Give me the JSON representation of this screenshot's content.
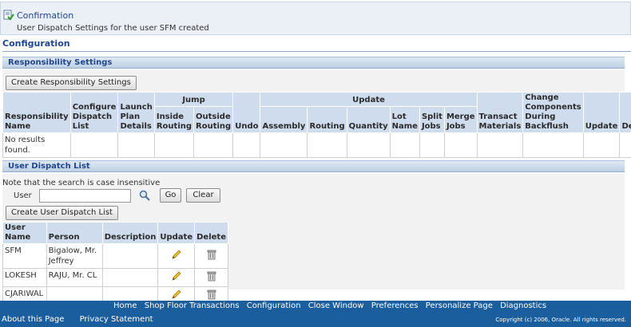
{
  "confirmation": {
    "title": "Confirmation",
    "message": "User Dispatch Settings for the user SFM created"
  },
  "page_title": "Configuration",
  "responsibility": {
    "header": "Responsibility Settings",
    "create_button": "Create Responsibility Settings",
    "group_jump": "Jump",
    "group_update": "Update",
    "columns": {
      "resp_name": "Responsibility Name",
      "configure": "Configure Dispatch List",
      "launch": "Launch Plan Details",
      "inside": "Inside Routing",
      "outside": "Outside Routing",
      "undo": "Undo",
      "assembly": "Assembly",
      "routing": "Routing",
      "quantity": "Quantity",
      "lot": "Lot Name",
      "split": "Split Jobs",
      "merge": "Merge Jobs",
      "transact": "Transact Materials",
      "change": "Change Components During Backflush",
      "update": "Update",
      "delete": "Delete"
    },
    "empty_text": "No results found."
  },
  "dispatch": {
    "header": "User Dispatch List",
    "note": "Note that the search is case insensitive",
    "user_label": "User",
    "user_value": "",
    "go_button": "Go",
    "clear_button": "Clear",
    "create_button": "Create User Dispatch List",
    "columns": {
      "user_name": "User Name",
      "person": "Person",
      "description": "Description",
      "update": "Update",
      "delete": "Delete"
    },
    "rows": [
      {
        "user_name": "SFM",
        "person": "Bigalow, Mr. Jeffrey",
        "description": ""
      },
      {
        "user_name": "LOKESH",
        "person": "RAJU, Mr. CL",
        "description": ""
      },
      {
        "user_name": "CJARIWAL",
        "person": "",
        "description": ""
      }
    ]
  },
  "footer": {
    "links": [
      "Home",
      "Shop Floor Transactions",
      "Configuration",
      "Close Window",
      "Preferences",
      "Personalize Page",
      "Diagnostics"
    ],
    "about": "About this Page",
    "privacy": "Privacy Statement",
    "copyright": "Copyright (c) 2006, Oracle. All rights reserved."
  },
  "colors": {
    "accent": "#21468b",
    "footer": "#1b5e9d",
    "header_cell": "#cfdced"
  }
}
